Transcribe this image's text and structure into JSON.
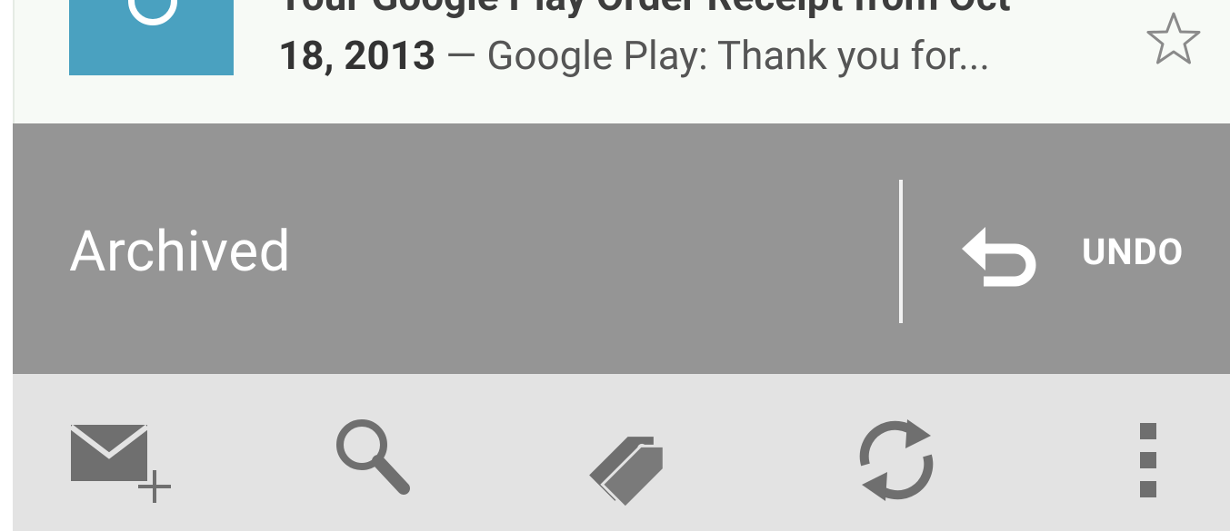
{
  "email": {
    "subject": "Your Google Play Order Receipt from Oct",
    "date_part": "18, 2013",
    "dash": " — ",
    "snippet": "Google Play: Thank you for..."
  },
  "snackbar": {
    "status_text": "Archived",
    "undo_label": "UNDO"
  },
  "action_bar": {
    "icons": [
      "compose-mail-icon",
      "search-icon",
      "labels-icon",
      "refresh-icon",
      "overflow-menu-icon"
    ]
  },
  "colors": {
    "avatar": "#4aa1c0",
    "snackbar_bg": "#959595",
    "action_bar_bg": "#e3e3e3",
    "row_bg": "#f7faf6",
    "icon_gray": "#6f6f6f"
  }
}
